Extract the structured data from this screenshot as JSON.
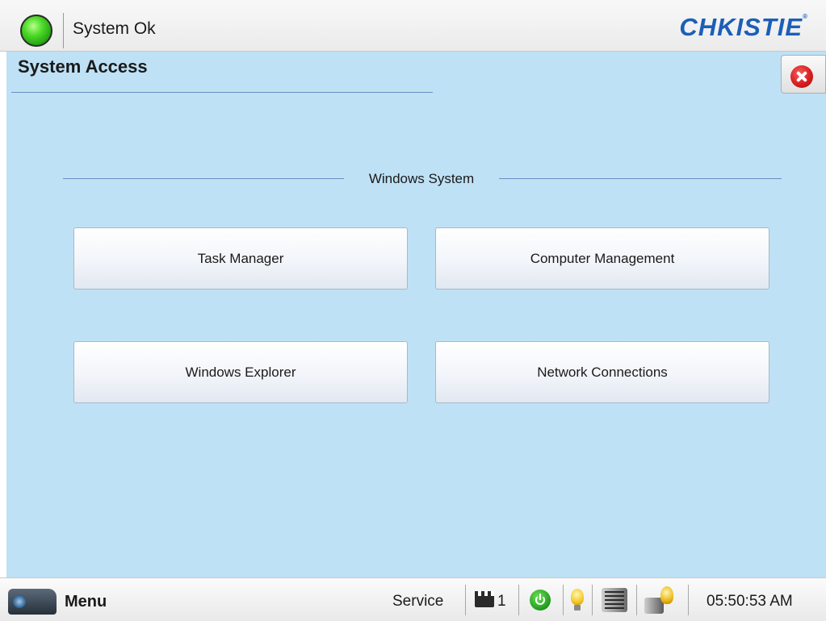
{
  "header": {
    "status_text": "System Ok",
    "logo_text": "CHKISTIE",
    "logo_mark": "®"
  },
  "page": {
    "title": "System Access",
    "section_title": "Windows System"
  },
  "buttons": {
    "task_manager": "Task Manager",
    "computer_management": "Computer Management",
    "windows_explorer": "Windows Explorer",
    "network_connections": "Network Connections"
  },
  "footer": {
    "menu_label": "Menu",
    "service_label": "Service",
    "cpl_count": "1",
    "clock": "05:50:53 AM"
  },
  "icons": {
    "status": "green-status-led-icon",
    "close": "close-icon",
    "menu": "projector-icon",
    "cpl": "clapper-icon",
    "power": "power-icon",
    "lamp": "lamp-bulb-icon",
    "cooling": "cooling-icon",
    "lamp_alert": "lamp-alert-icon"
  },
  "colors": {
    "panel_bg": "#bee1f5",
    "logo": "#1b5fb7",
    "status_ok": "#4fdc2a",
    "close_red": "#d81f1f",
    "accent_line": "#6b8fc4"
  }
}
